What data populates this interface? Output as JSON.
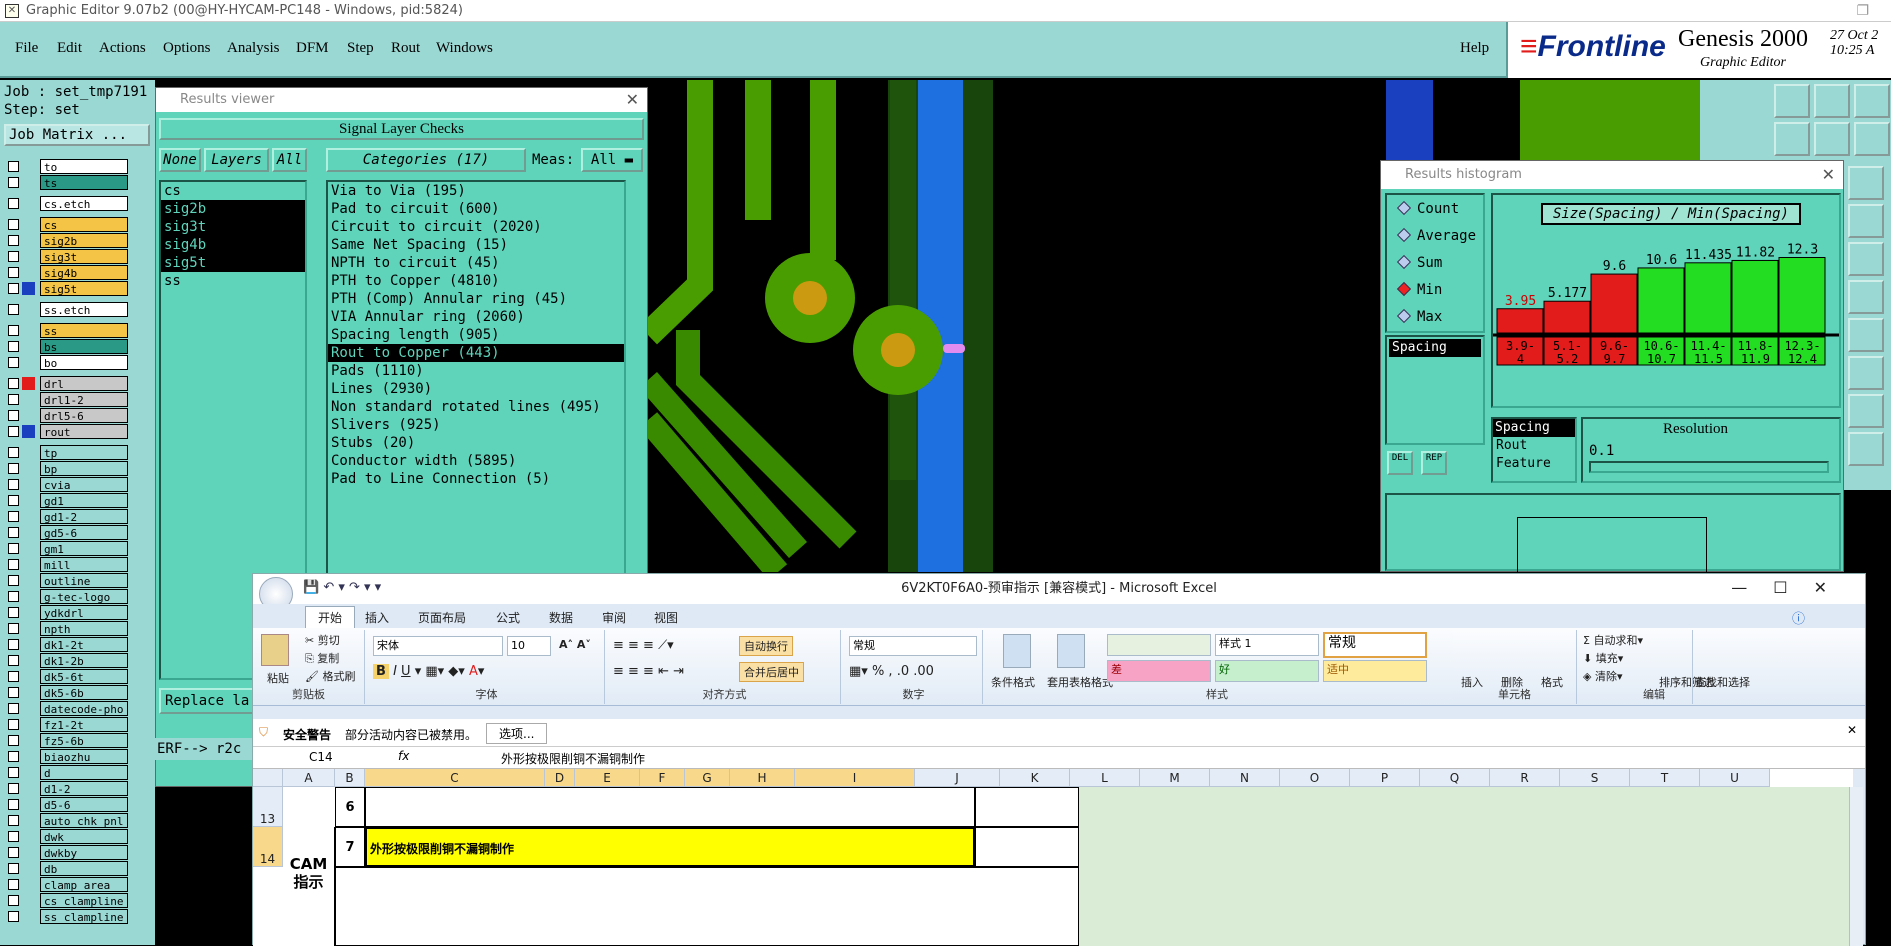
{
  "genesis": {
    "window_title": "Graphic Editor 9.07b2 (00@HY-HYCAM-PC148 - Windows, pid:5824)",
    "menu": [
      "File",
      "Edit",
      "Actions",
      "Options",
      "Analysis",
      "DFM",
      "Step",
      "Rout",
      "Windows"
    ],
    "help": "Help",
    "brand": {
      "logo": "Frontline",
      "product": "Genesis 2000",
      "subtitle": "Graphic Editor",
      "date": "27 Oct 2",
      "time": "10:25 A"
    },
    "job_label": "Job : set_tmp7191",
    "step_label": "Step: set",
    "job_matrix": "Job Matrix ...",
    "layers": [
      {
        "name": "to",
        "color": "#ffffff"
      },
      {
        "name": "ts",
        "color": "#2a9a86"
      },
      {
        "name": "cs.etch",
        "color": "#ffffff"
      },
      {
        "name": "cs",
        "color": "#f3c445"
      },
      {
        "name": "sig2b",
        "color": "#f3c445"
      },
      {
        "name": "sig3t",
        "color": "#f3c445"
      },
      {
        "name": "sig4b",
        "color": "#f3c445"
      },
      {
        "name": "sig5t",
        "color": "#f3c445"
      },
      {
        "name": "ss.etch",
        "color": "#ffffff"
      },
      {
        "name": "ss",
        "color": "#f3c445"
      },
      {
        "name": "bs",
        "color": "#2a9a86"
      },
      {
        "name": "bo",
        "color": "#ffffff"
      },
      {
        "name": "drl",
        "color": "#c8c8c8"
      },
      {
        "name": "drl1-2",
        "color": "#c8c8c8"
      },
      {
        "name": "drl5-6",
        "color": "#c8c8c8"
      },
      {
        "name": "rout",
        "color": "#c8c8c8"
      },
      {
        "name": "tp",
        "color": "#9ad8d4"
      },
      {
        "name": "bp",
        "color": "#9ad8d4"
      },
      {
        "name": "cvia",
        "color": "#9ad8d4"
      },
      {
        "name": "gd1",
        "color": "#9ad8d4"
      },
      {
        "name": "gd1-2",
        "color": "#9ad8d4"
      },
      {
        "name": "gd5-6",
        "color": "#9ad8d4"
      },
      {
        "name": "gm1",
        "color": "#9ad8d4"
      },
      {
        "name": "mill",
        "color": "#9ad8d4"
      },
      {
        "name": "outline",
        "color": "#9ad8d4"
      },
      {
        "name": "g-tec-logo",
        "color": "#9ad8d4"
      },
      {
        "name": "ydkdrl",
        "color": "#9ad8d4"
      },
      {
        "name": "npth",
        "color": "#9ad8d4"
      },
      {
        "name": "dk1-2t",
        "color": "#9ad8d4"
      },
      {
        "name": "dk1-2b",
        "color": "#9ad8d4"
      },
      {
        "name": "dk5-6t",
        "color": "#9ad8d4"
      },
      {
        "name": "dk5-6b",
        "color": "#9ad8d4"
      },
      {
        "name": "datecode-pho",
        "color": "#9ad8d4"
      },
      {
        "name": "fz1-2t",
        "color": "#9ad8d4"
      },
      {
        "name": "fz5-6b",
        "color": "#9ad8d4"
      },
      {
        "name": "biaozhu",
        "color": "#9ad8d4"
      },
      {
        "name": "d",
        "color": "#9ad8d4"
      },
      {
        "name": "d1-2",
        "color": "#9ad8d4"
      },
      {
        "name": "d5-6",
        "color": "#9ad8d4"
      },
      {
        "name": "auto_chk_pnl",
        "color": "#9ad8d4"
      },
      {
        "name": "dwk",
        "color": "#9ad8d4"
      },
      {
        "name": "dwkby",
        "color": "#9ad8d4"
      },
      {
        "name": "db",
        "color": "#9ad8d4"
      },
      {
        "name": "clamp_area",
        "color": "#9ad8d4"
      },
      {
        "name": "cs_clampline",
        "color": "#9ad8d4"
      },
      {
        "name": "ss_clampline",
        "color": "#9ad8d4"
      }
    ],
    "swatch_colors": {
      "sig5t": "#1a3fbf",
      "drl": "#e21b1b",
      "rout": "#1a3fbf"
    }
  },
  "results_viewer": {
    "title": "Results viewer",
    "header": "Signal Layer Checks",
    "none_btn": "None",
    "layers_btn": "Layers",
    "all_btn": "All",
    "categories_btn": "Categories (17)",
    "meas_label": "Meas:",
    "meas_value": "All",
    "layer_list": [
      "cs",
      "sig2b",
      "sig3t",
      "sig4b",
      "sig5t",
      "ss"
    ],
    "categories": [
      "Via to Via (195)",
      "Pad to circuit (600)",
      "Circuit to circuit (2020)",
      "Same Net Spacing (15)",
      "NPTH to circuit (45)",
      "PTH to Copper (4810)",
      "PTH (Comp) Annular ring (45)",
      "VIA Annular ring (2060)",
      "Spacing length (905)",
      "Rout to Copper (443)",
      "Pads (1110)",
      "Lines (2930)",
      "Non standard rotated lines (495)",
      "Slivers (925)",
      "Stubs (20)",
      "Conductor width (5895)",
      "Pad to Line Connection (5)"
    ],
    "replace_btn": "Replace la",
    "erf": "ERF--> r2c"
  },
  "histogram": {
    "title": "Results histogram",
    "options": [
      "Count",
      "Average",
      "Sum",
      "Min",
      "Max"
    ],
    "selected": "Min",
    "list_item": "Spacing",
    "del_btn": "DEL",
    "rep_btn": "REP",
    "chart_title": "Size(Spacing) / Min(Spacing)",
    "attrs": [
      "Spacing",
      "Rout",
      "Feature"
    ],
    "resolution_label": "Resolution",
    "resolution_value": "0.1"
  },
  "chart_data": {
    "type": "bar",
    "title": "Size(Spacing) / Min(Spacing)",
    "categories": [
      "3.9-4",
      "5.1-5.2",
      "9.6-9.7",
      "10.6-10.7",
      "11.4-11.5",
      "11.8-11.9",
      "12.3-12.4"
    ],
    "values": [
      3.95,
      5.177,
      9.6,
      10.6,
      11.435,
      11.82,
      12.3
    ],
    "bar_colors": [
      "#e21b1b",
      "#e21b1b",
      "#e21b1b",
      "#22dd22",
      "#22dd22",
      "#22dd22",
      "#22dd22"
    ],
    "ylim": [
      0,
      13
    ]
  },
  "excel": {
    "title": "6V2KT0F6A0-预审指示  [兼容模式] - Microsoft Excel",
    "tabs": [
      "开始",
      "插入",
      "页面布局",
      "公式",
      "数据",
      "审阅",
      "视图"
    ],
    "clipboard": {
      "paste": "粘贴",
      "cut": "剪切",
      "copy": "复制",
      "format_painter": "格式刷",
      "label": "剪贴板"
    },
    "font": {
      "name": "宋体",
      "size": "10",
      "label": "字体"
    },
    "alignment": {
      "wrap": "自动换行",
      "merge": "合并后居中",
      "label": "对齐方式"
    },
    "number": {
      "format": "常规",
      "label": "数字"
    },
    "styles": {
      "cond": "条件格式",
      "table": "套用表格格式",
      "s1": "样式 1",
      "normal": "常规",
      "bad": "差",
      "good": "好",
      "neutral": "适中",
      "label": "样式"
    },
    "cells": {
      "insert": "插入",
      "delete": "删除",
      "format": "格式",
      "label": "单元格"
    },
    "editing": {
      "autosum": "自动求和",
      "fill": "填充",
      "clear": "清除",
      "sort": "排序和筛选",
      "find": "查找和选择",
      "label": "编辑"
    },
    "security": {
      "label": "安全警告",
      "msg": "部分活动内容已被禁用。",
      "btn": "选项..."
    },
    "namebox": "C14",
    "formula": "外形按极限削铜不漏铜制作",
    "columns": [
      "A",
      "B",
      "C",
      "D",
      "E",
      "F",
      "G",
      "H",
      "I",
      "J",
      "K",
      "L",
      "M",
      "N",
      "O",
      "P",
      "Q",
      "R",
      "S",
      "T",
      "U"
    ],
    "rows": [
      {
        "num": "13",
        "b": "6",
        "c": ""
      },
      {
        "num": "14",
        "b": "7",
        "c": "外形按极限削铜不漏铜制作"
      }
    ],
    "side_label": "CAM\n指示"
  }
}
